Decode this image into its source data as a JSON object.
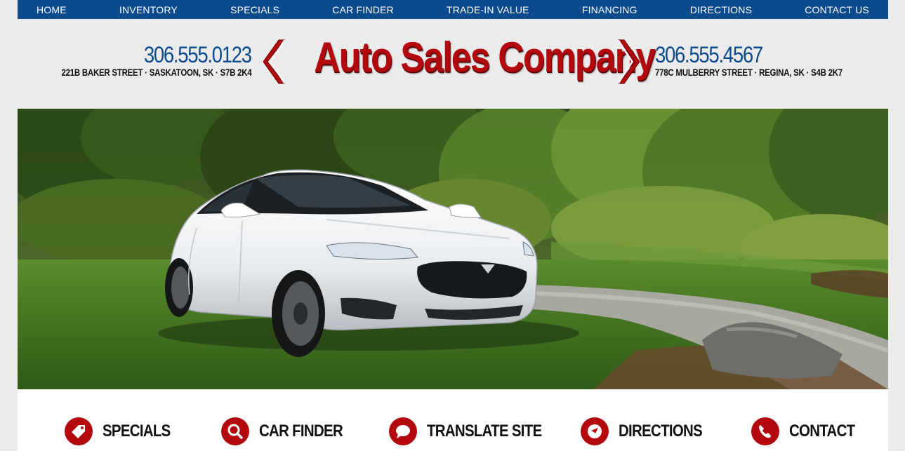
{
  "nav": {
    "items": [
      {
        "label": "HOME"
      },
      {
        "label": "INVENTORY"
      },
      {
        "label": "SPECIALS"
      },
      {
        "label": "CAR FINDER"
      },
      {
        "label": "TRADE-IN VALUE"
      },
      {
        "label": "FINANCING"
      },
      {
        "label": "DIRECTIONS"
      },
      {
        "label": "CONTACT US"
      }
    ]
  },
  "header": {
    "brand": "Auto Sales Company",
    "left_location": {
      "phone": "306.555.0123",
      "address": "221B BAKER STREET · SASKATOON, SK · S7B 2K4"
    },
    "right_location": {
      "phone": "306.555.4567",
      "address": "778C MULBERRY STREET · REGINA, SK · S4B 2K7"
    }
  },
  "hero": {
    "image_subject": "white sedan parked on grass"
  },
  "quick_links": [
    {
      "label": "SPECIALS",
      "icon": "tag-icon"
    },
    {
      "label": "CAR FINDER",
      "icon": "search-icon"
    },
    {
      "label": "TRANSLATE SITE",
      "icon": "chat-bubble-icon"
    },
    {
      "label": "DIRECTIONS",
      "icon": "compass-icon"
    },
    {
      "label": "CONTACT",
      "icon": "phone-icon"
    }
  ],
  "colors": {
    "nav_bg": "#0b4a8c",
    "brand_red": "#b3080e",
    "phone_blue": "#0b4a8c",
    "page_bg": "#ececec"
  }
}
